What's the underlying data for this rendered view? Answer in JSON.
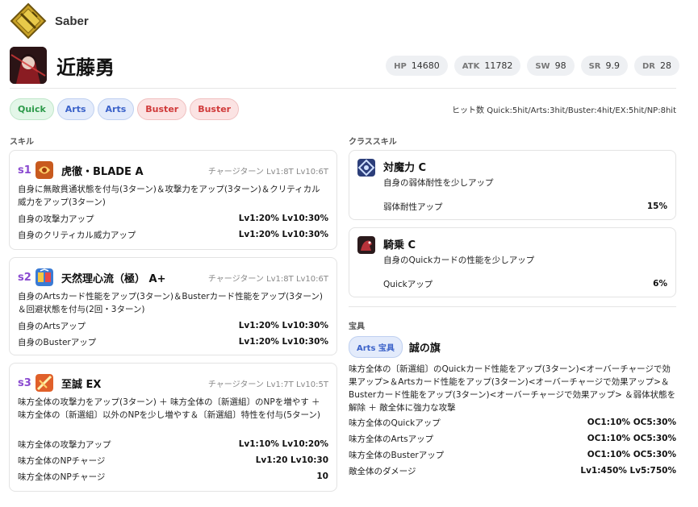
{
  "servant": {
    "class_name": "Saber",
    "name": "近藤勇",
    "stats": [
      {
        "key": "HP",
        "value": "14680"
      },
      {
        "key": "ATK",
        "value": "11782"
      },
      {
        "key": "SW",
        "value": "98"
      },
      {
        "key": "SR",
        "value": "9.9"
      },
      {
        "key": "DR",
        "value": "28"
      }
    ]
  },
  "cards": [
    "Quick",
    "Arts",
    "Arts",
    "Buster",
    "Buster"
  ],
  "hits": "ヒット数 Quick:5hit/Arts:3hit/Buster:4hit/EX:5hit/NP:8hit",
  "sections": {
    "skills": "スキル",
    "class_skills": "クラススキル",
    "np": "宝具"
  },
  "skills": [
    {
      "num": "s1",
      "name": "虎徹・BLADE A",
      "ct": "チャージターン Lv1:8T Lv10:6T",
      "desc": "自身に無敵貫通状態を付与(3ターン)＆攻撃力をアップ(3ターン)＆クリティカル威力をアップ(3ターン)",
      "effects": [
        {
          "label": "自身の攻撃力アップ",
          "value": "Lv1:20% Lv10:30%"
        },
        {
          "label": "自身のクリティカル威力アップ",
          "value": "Lv1:20% Lv10:30%"
        }
      ]
    },
    {
      "num": "s2",
      "name": "天然理心流（極） A+",
      "ct": "チャージターン Lv1:8T Lv10:6T",
      "desc": "自身のArtsカード性能をアップ(3ターン)＆Busterカード性能をアップ(3ターン)＆回避状態を付与(2回・3ターン)",
      "effects": [
        {
          "label": "自身のArtsアップ",
          "value": "Lv1:20% Lv10:30%"
        },
        {
          "label": "自身のBusterアップ",
          "value": "Lv1:20% Lv10:30%"
        }
      ]
    },
    {
      "num": "s3",
      "name": "至誠 EX",
      "ct": "チャージターン Lv1:7T Lv10:5T",
      "desc": "味方全体の攻撃力をアップ(3ターン) ＋ 味方全体の〔新選組〕のNPを増やす ＋ 味方全体の〔新選組〕以外のNPを少し増やす＆〔新選組〕特性を付与(5ターン)",
      "effects": [
        {
          "label": "味方全体の攻撃力アップ",
          "value": "Lv1:10% Lv10:20%"
        },
        {
          "label": "味方全体のNPチャージ",
          "value": "Lv1:20 Lv10:30"
        },
        {
          "label": "味方全体のNPチャージ",
          "value": "10"
        }
      ]
    }
  ],
  "class_skills": [
    {
      "name": "対魔力 C",
      "desc": "自身の弱体耐性を少しアップ",
      "effect": {
        "label": "弱体耐性アップ",
        "value": "15%"
      }
    },
    {
      "name": "騎乗 C",
      "desc": "自身のQuickカードの性能を少しアップ",
      "effect": {
        "label": "Quickアップ",
        "value": "6%"
      }
    }
  ],
  "np": {
    "badge": "Arts 宝具",
    "name": "誠の旗",
    "desc": "味方全体の〔新選組〕のQuickカード性能をアップ(3ターン)<オーバーチャージで効果アップ>＆Artsカード性能をアップ(3ターン)<オーバーチャージで効果アップ>＆Busterカード性能をアップ(3ターン)<オーバーチャージで効果アップ> ＆弱体状態を解除 ＋ 敵全体に強力な攻撃",
    "effects": [
      {
        "label": "味方全体のQuickアップ",
        "value": "OC1:10% OC5:30%"
      },
      {
        "label": "味方全体のArtsアップ",
        "value": "OC1:10% OC5:30%"
      },
      {
        "label": "味方全体のBusterアップ",
        "value": "OC1:10% OC5:30%"
      },
      {
        "label": "敵全体のダメージ",
        "value": "Lv1:450% Lv5:750%"
      }
    ]
  },
  "colors": {
    "quick": "#2d9a4a",
    "arts": "#3b62c9",
    "buster": "#d03a3a",
    "skill_num": "#8a4ad0"
  }
}
